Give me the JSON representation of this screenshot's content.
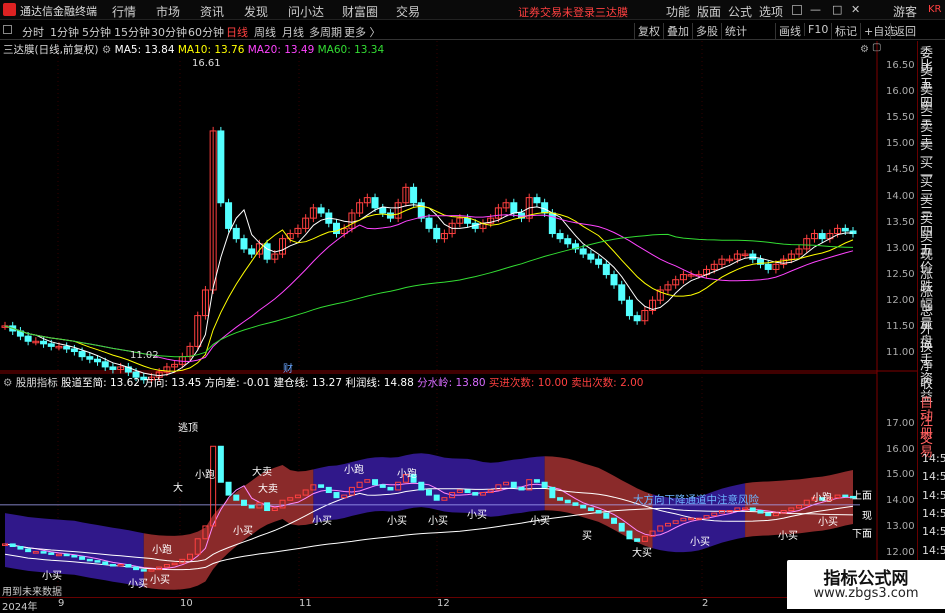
{
  "menubar": {
    "title": "通达信金融终端",
    "items": [
      "行情",
      "市场",
      "资讯",
      "发现",
      "问小达",
      "财富圈",
      "交易"
    ],
    "warning": "证券交易未登录",
    "stock": "三达膜",
    "right": [
      "功能",
      "版面",
      "公式",
      "选项"
    ],
    "user": "游客"
  },
  "toolbar": {
    "periods": [
      "分时",
      "1分钟",
      "5分钟",
      "15分钟",
      "30分钟",
      "60分钟",
      "日线",
      "周线",
      "月线",
      "多周期",
      "更多 〉"
    ],
    "active": "日线",
    "right": [
      "复权",
      "叠加",
      "多股",
      "统计",
      "画线",
      "F10",
      "标记",
      "+自选",
      "返回"
    ]
  },
  "main_legend": {
    "name": "三达膜(日线,前复权)",
    "ma5": "MA5: 13.84",
    "ma10": "MA10: 13.76",
    "ma20": "MA20: 13.49",
    "ma60": "MA60: 13.34"
  },
  "main_annotations": {
    "high": "16.61",
    "low": "11.02",
    "cai": "财"
  },
  "main_yaxis": [
    "16.50",
    "16.00",
    "15.50",
    "15.00",
    "14.50",
    "14.00",
    "13.50",
    "13.00",
    "12.50",
    "12.00",
    "11.50",
    "11.00"
  ],
  "sub_legend": {
    "name": "股朋指标",
    "a": "股道至简: 13.62",
    "b": "方向: 13.45",
    "c": "方向差: -0.01",
    "d": "建仓线: 13.27",
    "e": "利润线: 14.88",
    "f": "分水岭: 13.80",
    "g": "买进次数: 10.00",
    "h": "卖出次数: 2.00"
  },
  "sub_yaxis": [
    "17.00",
    "16.00",
    "15.00",
    "14.00",
    "13.00",
    "12.00"
  ],
  "sub_labels": {
    "taoding": "逃顶",
    "xiaopao": "小跑",
    "damai": "大卖",
    "xiaomai": "小卖",
    "damai2": "大买",
    "xiaomai2": "小买",
    "channel": "大方向下降通道中注意风险",
    "shangmian": "上面",
    "xianmian": "下面",
    "xian": "现",
    "future": "用到未来数据",
    "l1": "小买",
    "l2": "小买",
    "l3": "小买",
    "l4": "小跑",
    "l5": "小跑",
    "l6": "大卖",
    "l7": "小卖",
    "l8": "大",
    "l9": "小跑",
    "l10": "小买",
    "l11": "小买",
    "l12": "小买",
    "l13": "小买",
    "l14": "小买",
    "l15": "小买",
    "l16": "大买",
    "l17": "小买",
    "l18": "小跑",
    "l19": "小买",
    "l20": "小买",
    "l21": "买"
  },
  "xaxis": {
    "year": "2024年",
    "ticks": [
      "9",
      "10",
      "11",
      "12",
      "2"
    ]
  },
  "rightpanel": [
    "KR",
    "委比",
    "卖五",
    "卖四",
    "卖三",
    "卖二",
    "卖一",
    "买一",
    "买二",
    "买三",
    "买四",
    "买五",
    "现价",
    "涨跌",
    "涨幅",
    "总量",
    "外盘",
    "换手",
    "净资",
    "收益",
    "自动",
    "注册",
    "交易",
    "14:5",
    "14:5",
    "14:5",
    "14:5",
    "14:5",
    "14:5",
    "14:5",
    "14:5"
  ],
  "watermark": {
    "line1": "指标公式网",
    "line2": "www.zbgs3.com"
  }
}
